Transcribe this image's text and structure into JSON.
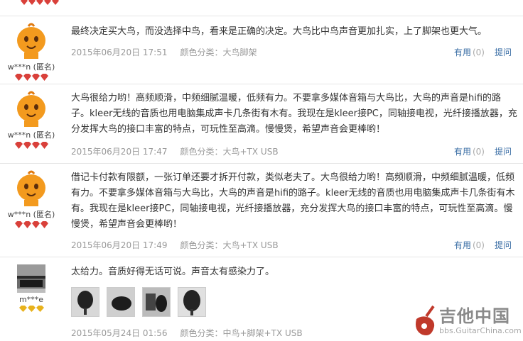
{
  "reviews": [
    {
      "user": "w***n (匿名)",
      "rank_color": "#d9403a",
      "rank_count": 4,
      "content": "最终决定买大鸟，而没选择中鸟，看来是正确的决定。大鸟比中鸟声音更加扎实，上了脚架也更大气。",
      "date": "2015年06月20日 17:51",
      "color_label": "颜色分类：",
      "color_value": "大鸟脚架",
      "useful": "有用",
      "count": "(0)",
      "ask": "提问"
    },
    {
      "user": "w***n (匿名)",
      "rank_color": "#d9403a",
      "rank_count": 4,
      "content": "大鸟很给力哟！高频顺滑，中频细腻温暖，低频有力。不要拿多媒体音箱与大鸟比，大鸟的声音是hifi的路子。kleer无线的音质也用电脑集成声卡几条街有木有。我现在是kleer接PC，同轴接电视，光纤接播放器，充分发挥大鸟的接口丰富的特点，可玩性至高滴。慢慢煲，希望声音会更棒哟！",
      "date": "2015年06月20日 17:47",
      "color_label": "颜色分类：",
      "color_value": "大鸟+TX USB",
      "useful": "有用",
      "count": "(0)",
      "ask": "提问"
    },
    {
      "user": "w***n (匿名)",
      "rank_color": "#d9403a",
      "rank_count": 4,
      "content": "借记卡付款有限额，一张订单还要才拆开付款，类似老夫了。大鸟很给力哟！高频顺滑，中频细腻温暖，低频有力。不要拿多媒体音箱与大鸟比，大鸟的声音是hifi的路子。kleer无线的音质也用电脑集成声卡几条街有木有。我现在是kleer接PC，同轴接电视，光纤接播放器，充分发挥大鸟的接口丰富的特点，可玩性至高滴。慢慢煲，希望声音会更棒哟！",
      "date": "2015年06月20日 17:49",
      "color_label": "颜色分类：",
      "color_value": "大鸟+TX USB",
      "useful": "有用",
      "count": "(0)",
      "ask": "提问"
    },
    {
      "user": "m***e",
      "rank_color": "#e8b21c",
      "rank_count": 3,
      "content": "太给力。音质好得无话可说。声音太有感染力了。",
      "date": "2015年05月24日 01:56",
      "color_label": "颜色分类：",
      "color_value": "中鸟+脚架+TX USB",
      "useful": "有用",
      "count": "(0)",
      "ask": "提问"
    }
  ],
  "watermark": {
    "title": "吉他中国",
    "url": "bbs.GuitarChina.com"
  }
}
